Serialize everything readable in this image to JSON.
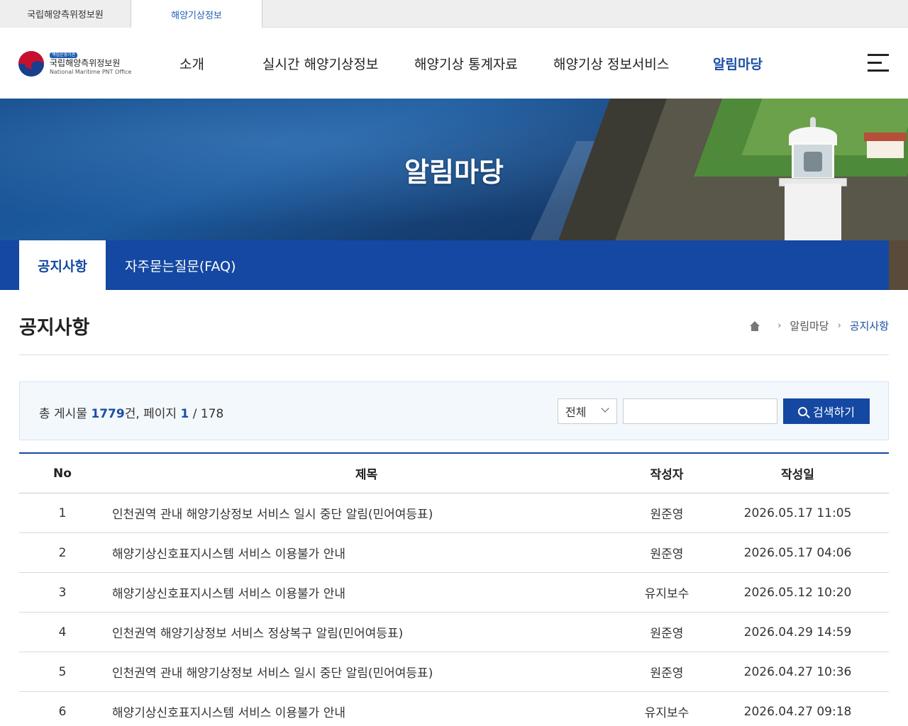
{
  "site_tabs": [
    "국립해양측위정보원",
    "해양기상정보"
  ],
  "logo": {
    "badge": "책임운영기관",
    "name_kr": "국립해양측위정보원",
    "name_en": "National Maritime PNT Office"
  },
  "nav": [
    "소개",
    "실시간 해양기상정보",
    "해양기상 통계자료",
    "해양기상 정보서비스",
    "알림마당"
  ],
  "banner": {
    "title": "알림마당"
  },
  "subtabs": [
    "공지사항",
    "자주묻는질문(FAQ)"
  ],
  "page": {
    "title": "공지사항",
    "breadcrumb": [
      "알림마당",
      "공지사항"
    ]
  },
  "search": {
    "total_prefix": "총 게시물 ",
    "total_count": "1779",
    "total_mid": "건, 페이지 ",
    "page_current": "1",
    "page_total": " / 178",
    "select_value": "전체",
    "input_value": "",
    "button_label": "검색하기"
  },
  "table": {
    "headers": [
      "No",
      "제목",
      "작성자",
      "작성일"
    ],
    "rows": [
      {
        "no": "1",
        "title": "인천권역 관내 해양기상정보 서비스 일시 중단 알림(민어여등표)",
        "writer": "원준영",
        "date": "2026.05.17 11:05"
      },
      {
        "no": "2",
        "title": "해양기상신호표지시스템 서비스 이용불가 안내",
        "writer": "원준영",
        "date": "2026.05.17 04:06"
      },
      {
        "no": "3",
        "title": "해양기상신호표지시스템 서비스 이용불가 안내",
        "writer": "유지보수",
        "date": "2026.05.12 10:20"
      },
      {
        "no": "4",
        "title": "인천권역 해양기상정보 서비스 정상복구 알림(민어여등표)",
        "writer": "원준영",
        "date": "2026.04.29 14:59"
      },
      {
        "no": "5",
        "title": "인천권역 관내 해양기상정보 서비스 일시 중단 알림(민어여등표)",
        "writer": "원준영",
        "date": "2026.04.27 10:36"
      },
      {
        "no": "6",
        "title": "해양기상신호표지시스템 서비스 이용불가 안내",
        "writer": "유지보수",
        "date": "2026.04.27 09:18"
      }
    ]
  }
}
